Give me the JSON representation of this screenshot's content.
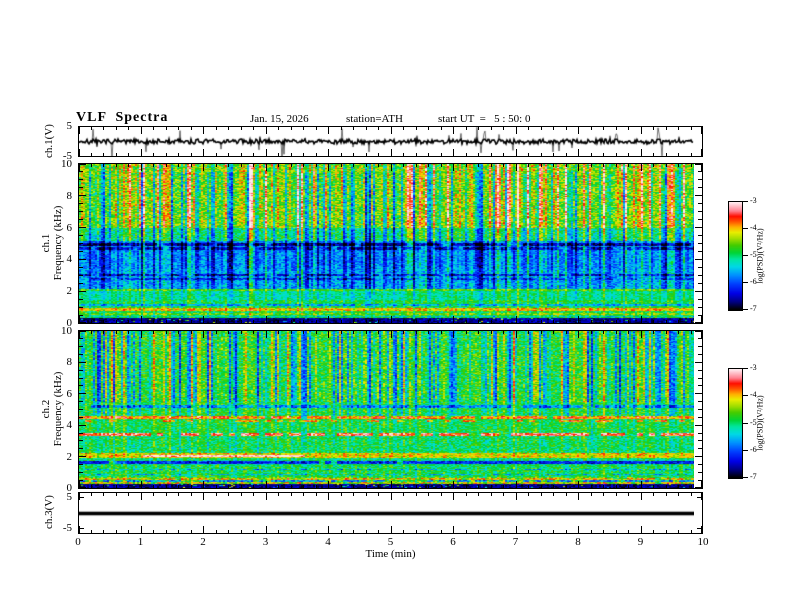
{
  "title": "VLF  Spectra",
  "annotations": {
    "date": "Jan. 15, 2026",
    "station": "station=ATH",
    "start_ut": "start UT  =   5 : 50: 0"
  },
  "xaxis": {
    "label": "Time  (min)",
    "range": [
      0,
      10
    ],
    "ticks": [
      0,
      1,
      2,
      3,
      4,
      5,
      6,
      7,
      8,
      9,
      10
    ],
    "minor_step": 0.2
  },
  "panels": {
    "wave1": {
      "ylabel": "ch.1(V)",
      "yticks": [
        5,
        -5
      ],
      "range": [
        -5,
        5
      ]
    },
    "spec1": {
      "ylabel_line1": "ch.1",
      "ylabel_line2": "Frequency  (kHz)",
      "yticks": [
        0,
        2,
        4,
        6,
        8,
        10
      ],
      "minor_step": 0.5,
      "range": [
        0,
        10
      ]
    },
    "spec2": {
      "ylabel_line1": "ch.2",
      "ylabel_line2": "Frequency  (kHz)",
      "yticks": [
        0,
        2,
        4,
        6,
        8,
        10
      ],
      "minor_step": 0.5,
      "range": [
        0,
        10
      ]
    },
    "wave3": {
      "ylabel": "ch.3(V)",
      "yticks": [
        5,
        -5
      ],
      "range": [
        -5,
        5
      ]
    }
  },
  "colorbar": {
    "label": "log(PSD)(V²/Hz)",
    "ticks": [
      -3,
      -4,
      -5,
      -6,
      -7
    ],
    "range": [
      -7,
      -3
    ]
  },
  "colors": {
    "background": "#ffffff",
    "foreground": "#000000",
    "colormap_stops": [
      [
        0.0,
        "#000000"
      ],
      [
        0.07,
        "#000080"
      ],
      [
        0.15,
        "#0000e6"
      ],
      [
        0.24,
        "#0040ff"
      ],
      [
        0.32,
        "#0090ff"
      ],
      [
        0.4,
        "#00d9e6"
      ],
      [
        0.47,
        "#00e6a0"
      ],
      [
        0.53,
        "#00d435"
      ],
      [
        0.6,
        "#44cc00"
      ],
      [
        0.66,
        "#a0dd00"
      ],
      [
        0.72,
        "#e8ee00"
      ],
      [
        0.77,
        "#ffb000"
      ],
      [
        0.82,
        "#ff5500"
      ],
      [
        0.87,
        "#ff0e00"
      ],
      [
        0.92,
        "#ff8090"
      ],
      [
        1.0,
        "#ffecf0"
      ]
    ]
  },
  "chart_data": [
    {
      "type": "line",
      "title": "ch.1 voltage waveform",
      "xlabel": "Time (min)",
      "ylabel": "ch.1(V)",
      "x_range": [
        0,
        9.84
      ],
      "y_range": [
        -5,
        5
      ],
      "description": "broadband noise around 0 V with frequent impulsive spikes reaching ±5 V",
      "noise_amp_V": 0.9,
      "spike_prob": 0.055,
      "spike_min_V": 1.5,
      "spike_extra_V": 3.3
    },
    {
      "type": "heatmap",
      "title": "ch.1 VLF spectrogram",
      "xlabel": "Time (min)",
      "ylabel": "ch.1 Frequency (kHz)",
      "x_range": [
        0,
        9.84
      ],
      "y_range": [
        0,
        10
      ],
      "z_label": "log(PSD)(V²/Hz)",
      "z_range": [
        -7,
        -3
      ],
      "stripes": {
        "bright_pow": 3,
        "bright_scale": 1.3,
        "dark_prob": 0.35
      },
      "bands": [
        {
          "f": [
            9.5,
            10.01
          ],
          "base": 0.61,
          "noise": 0.15,
          "bright": 0.33,
          "dark": 0.3
        },
        {
          "f": [
            6.0,
            9.5
          ],
          "base": 0.6,
          "noise": 0.14,
          "bright": 0.34,
          "dark": 0.45
        },
        {
          "f": [
            5.2,
            6.0
          ],
          "base": 0.47,
          "noise": 0.12,
          "bright": 0.24,
          "dark": 0.4
        },
        {
          "f": [
            3.4,
            5.2
          ],
          "base": 0.3,
          "noise": 0.1,
          "bright": 0.18,
          "dark": 0.3
        },
        {
          "f": [
            2.2,
            3.4
          ],
          "base": 0.33,
          "noise": 0.11,
          "bright": 0.15,
          "dark": 0.25
        },
        {
          "f": [
            1.45,
            2.2
          ],
          "base": 0.46,
          "noise": 0.08,
          "bright": 0.1,
          "dark": 0.12
        },
        {
          "f": [
            0.35,
            1.45
          ],
          "base": 0.52,
          "noise": 0.1,
          "bright": 0.08,
          "dark": 0.1
        },
        {
          "f": [
            0.0,
            0.35
          ],
          "base": 0.07,
          "noise": 0.06,
          "bright": 0.03,
          "dark": 0.0
        }
      ],
      "hlines": [
        {
          "f": 4.95,
          "dv": -0.22,
          "hw": 0.1,
          "duty": 0.9
        },
        {
          "f": 4.7,
          "dv": -0.18,
          "hw": 0.08,
          "duty": 0.8
        },
        {
          "f": 3.05,
          "dv": -0.2,
          "hw": 0.08,
          "duty": 0.85
        },
        {
          "f": 2.8,
          "dv": -0.15,
          "hw": 0.07,
          "duty": 0.8
        },
        {
          "f": 2.1,
          "dv": 0.12,
          "hw": 0.08,
          "duty": 1.0
        },
        {
          "f": 1.15,
          "dv": -0.18,
          "hw": 0.07,
          "duty": 0.9
        },
        {
          "f": 0.9,
          "dv": 0.22,
          "hw": 0.1,
          "duty": 1.0
        },
        {
          "f": 0.6,
          "dv": 0.1,
          "hw": 0.07,
          "duty": 1.0
        },
        {
          "f": 0.45,
          "dv": -0.12,
          "hw": 0.05,
          "duty": 0.8
        }
      ]
    },
    {
      "type": "heatmap",
      "title": "ch.2 VLF spectrogram",
      "xlabel": "Time (min)",
      "ylabel": "ch.2 Frequency (kHz)",
      "x_range": [
        0,
        9.84
      ],
      "y_range": [
        0,
        10
      ],
      "z_label": "log(PSD)(V²/Hz)",
      "z_range": [
        -7,
        -3
      ],
      "stripes": {
        "bright_pow": 4,
        "bright_scale": 1.0,
        "dark_prob": 0.4
      },
      "bands": [
        {
          "f": [
            5.5,
            10.01
          ],
          "base": 0.55,
          "noise": 0.12,
          "bright": 0.22,
          "dark": 0.42
        },
        {
          "f": [
            4.55,
            5.5
          ],
          "base": 0.54,
          "noise": 0.11,
          "bright": 0.12,
          "dark": 0.25
        },
        {
          "f": [
            3.5,
            4.55
          ],
          "base": 0.54,
          "noise": 0.1,
          "bright": 0.08,
          "dark": 0.12
        },
        {
          "f": [
            2.2,
            3.5
          ],
          "base": 0.52,
          "noise": 0.11,
          "bright": 0.06,
          "dark": 0.1
        },
        {
          "f": [
            1.5,
            2.2
          ],
          "base": 0.5,
          "noise": 0.1,
          "bright": 0.05,
          "dark": 0.08
        },
        {
          "f": [
            0.75,
            1.5
          ],
          "base": 0.53,
          "noise": 0.11,
          "bright": 0.05,
          "dark": 0.08
        },
        {
          "f": [
            0.28,
            0.75
          ],
          "base": 0.58,
          "noise": 0.14,
          "bright": 0.04,
          "dark": 0.06
        },
        {
          "f": [
            0.0,
            0.28
          ],
          "base": 0.07,
          "noise": 0.06,
          "bright": 0.03,
          "dark": 0.0
        }
      ],
      "hlines": [
        {
          "f": 5.2,
          "dv": -0.2,
          "hw": 0.09,
          "duty": 0.85
        },
        {
          "f": 4.5,
          "dv": 0.28,
          "hw": 0.09,
          "duty": 0.95
        },
        {
          "f": 4.3,
          "dv": 0.26,
          "hw": 0.06,
          "duty": 0.3
        },
        {
          "f": 3.45,
          "dv": 0.38,
          "hw": 0.09,
          "duty": 0.75
        },
        {
          "f": 2.1,
          "dv": 0.22,
          "hw": 0.13,
          "duty": 1.0
        },
        {
          "f": 2.08,
          "dv": 0.28,
          "hw": 0.07,
          "duty": 0.95,
          "x": [
            1.0,
            3.6
          ]
        },
        {
          "f": 1.65,
          "dv": -0.3,
          "hw": 0.07,
          "duty": 0.95
        },
        {
          "f": 1.2,
          "dv": -0.2,
          "hw": 0.05,
          "duty": 0.5
        },
        {
          "f": 0.9,
          "dv": -0.18,
          "hw": 0.05,
          "duty": 0.5
        },
        {
          "f": 0.62,
          "dv": 0.15,
          "hw": 0.07,
          "duty": 0.9
        },
        {
          "f": 0.48,
          "dv": -0.25,
          "hw": 0.05,
          "duty": 0.7
        },
        {
          "f": 0.35,
          "dv": 0.12,
          "hw": 0.05,
          "duty": 0.9
        }
      ]
    },
    {
      "type": "line",
      "title": "ch.3 voltage waveform",
      "xlabel": "Time (min)",
      "ylabel": "ch.3(V)",
      "x_range": [
        0,
        9.84
      ],
      "y_range": [
        -5,
        5
      ],
      "description": "constant ≈ 0 V (flat thick black trace, no signal)",
      "value_V": 0
    }
  ]
}
